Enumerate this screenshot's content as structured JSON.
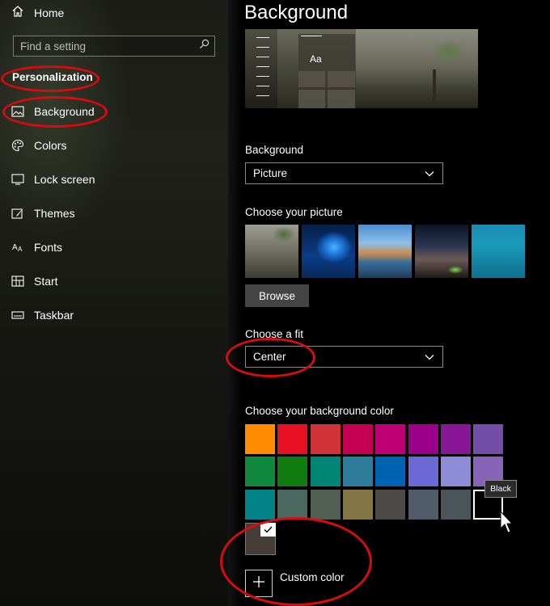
{
  "sidebar": {
    "home_label": "Home",
    "search_placeholder": "Find a setting",
    "section_title": "Personalization",
    "items": [
      {
        "label": "Background",
        "icon": "picture-icon"
      },
      {
        "label": "Colors",
        "icon": "palette-icon"
      },
      {
        "label": "Lock screen",
        "icon": "lock-screen-icon"
      },
      {
        "label": "Themes",
        "icon": "themes-brush-icon"
      },
      {
        "label": "Fonts",
        "icon": "fonts-icon"
      },
      {
        "label": "Start",
        "icon": "start-grid-icon"
      },
      {
        "label": "Taskbar",
        "icon": "taskbar-icon"
      }
    ]
  },
  "main": {
    "title": "Background",
    "preview": {
      "sample_text": "Aa"
    },
    "background_label": "Background",
    "background_value": "Picture",
    "choose_picture_label": "Choose your picture",
    "browse_label": "Browse",
    "fit_label": "Choose a fit",
    "fit_value": "Center",
    "color_label": "Choose your background color",
    "swatch_colors": [
      "#ff8c00",
      "#e81123",
      "#d13438",
      "#c30052",
      "#bf0077",
      "#9a0089",
      "#881798",
      "#744da9",
      "#10893e",
      "#107c10",
      "#018574",
      "#2d7d9a",
      "#0063b1",
      "#6b69d6",
      "#8e8cd8",
      "#8764b8",
      "#038387",
      "#486860",
      "#525e54",
      "#847545",
      "#4c4a48",
      "#515c6b",
      "#4a5459",
      "#000000"
    ],
    "selected_swatch_index": 23,
    "tooltip": "Black",
    "custom_swatch_color": "#463d38",
    "custom_color_label": "Custom color"
  },
  "colors": {
    "annotation_red": "#d70d0d",
    "sidebar_bg": "#1b1c17"
  }
}
